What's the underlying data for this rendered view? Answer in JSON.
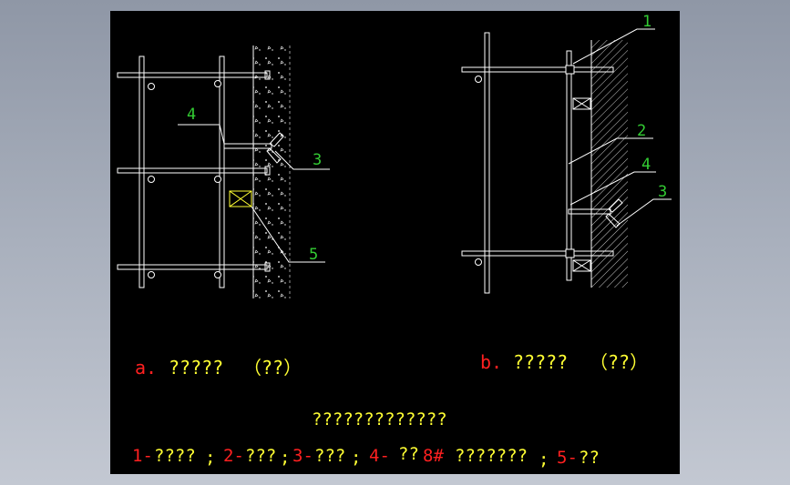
{
  "drawing": {
    "colors": {
      "background": "#000000",
      "frame": "#ffffff",
      "leader": "#ffffff",
      "callout_number": "#33cc33",
      "caption_prefix": "#ff2020",
      "caption_text": "#ffff33",
      "hatch": "#ffffff",
      "block": "#ffff33"
    },
    "figure_a": {
      "prefix": "a.",
      "caption": "?????",
      "caption_paren": "（??）",
      "callouts": [
        "4",
        "3",
        "5"
      ]
    },
    "figure_b": {
      "prefix": "b.",
      "caption": "?????",
      "caption_paren": "（??）",
      "callouts": [
        "1",
        "2",
        "4",
        "3"
      ]
    },
    "title": "?????????????",
    "legend": [
      {
        "id": "1-",
        "text": "????",
        "sep": ";"
      },
      {
        "id": "2-",
        "text": "???",
        "sep": ";"
      },
      {
        "id": "3-",
        "text": "???",
        "sep": ";"
      },
      {
        "id": "4-",
        "text": "??",
        "spec": "8#",
        "text2": "???????",
        "sep": ";"
      },
      {
        "id": "5-",
        "text": "??",
        "sep": ""
      }
    ]
  }
}
